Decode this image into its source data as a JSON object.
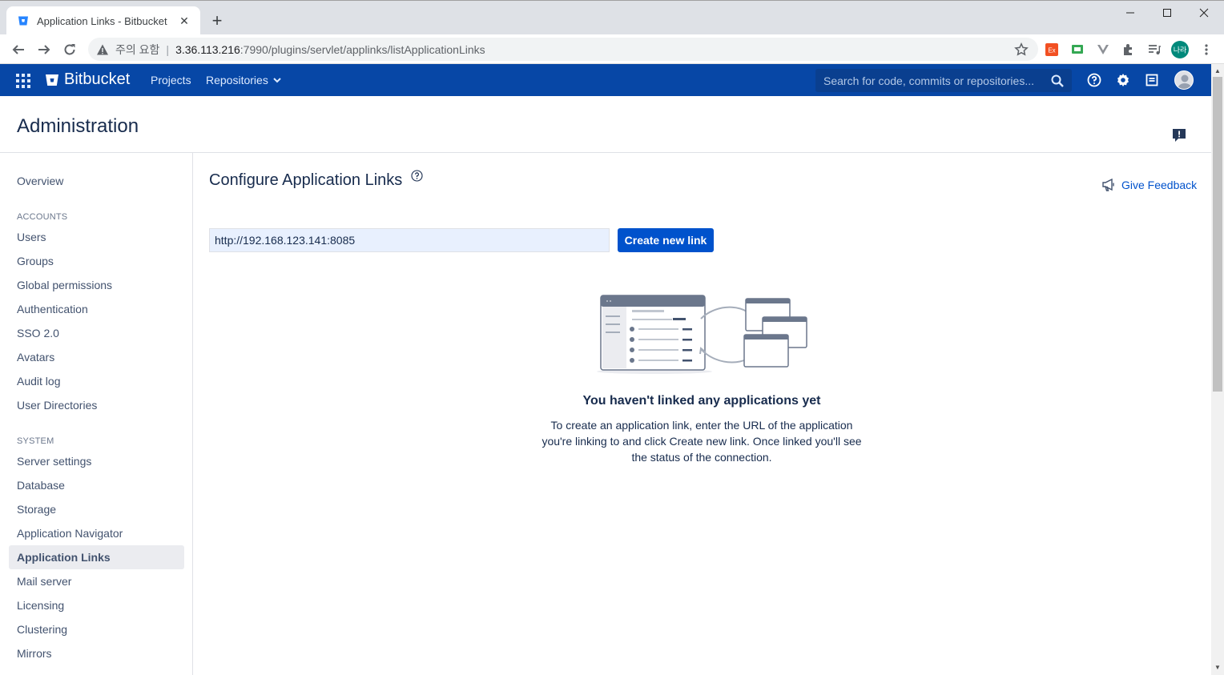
{
  "browser": {
    "tab_title": "Application Links - Bitbucket",
    "security_label": "주의 요함",
    "url_host": "3.36.113.216",
    "url_rest": ":7990/plugins/servlet/applinks/listApplicationLinks",
    "profile_label": "나라"
  },
  "header": {
    "logo_text": "Bitbucket",
    "nav": [
      "Projects",
      "Repositories"
    ],
    "search_placeholder": "Search for code, commits or repositories..."
  },
  "admin": {
    "title": "Administration"
  },
  "sidebar": {
    "overview": "Overview",
    "accounts_heading": "ACCOUNTS",
    "accounts": [
      "Users",
      "Groups",
      "Global permissions",
      "Authentication",
      "SSO 2.0",
      "Avatars",
      "Audit log",
      "User Directories"
    ],
    "system_heading": "SYSTEM",
    "system": [
      "Server settings",
      "Database",
      "Storage",
      "Application Navigator",
      "Application Links",
      "Mail server",
      "Licensing",
      "Clustering",
      "Mirrors"
    ],
    "active": "Application Links"
  },
  "main": {
    "title": "Configure Application Links",
    "give_feedback": "Give Feedback",
    "url_value": "http://192.168.123.141:8085",
    "create_button": "Create new link",
    "empty_title": "You haven't linked any applications yet",
    "empty_desc": "To create an application link, enter the URL of the application you're linking to and click Create new link. Once linked you'll see the status of the connection."
  },
  "colors": {
    "header_bg": "#0747a6",
    "primary_button": "#0052cc",
    "active_item_bg": "#ebecf0"
  }
}
